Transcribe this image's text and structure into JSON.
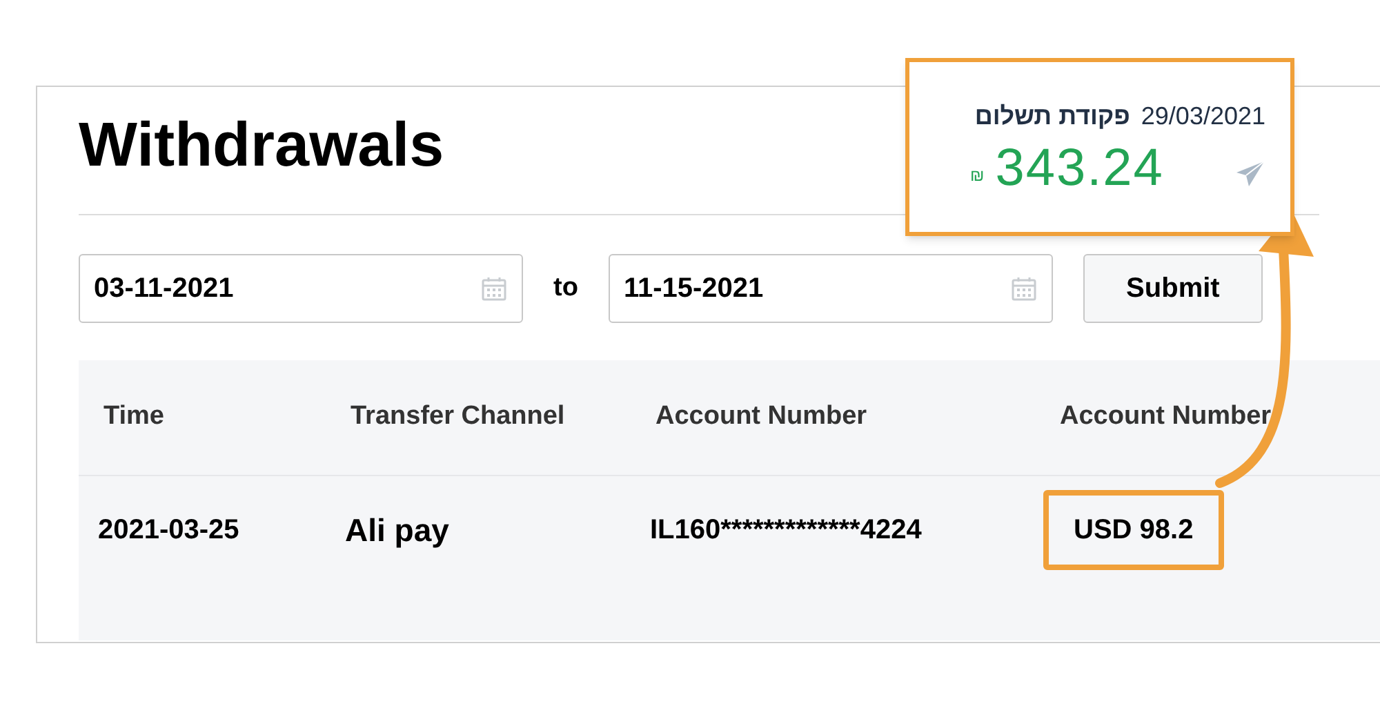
{
  "page": {
    "title": "Withdrawals"
  },
  "filter": {
    "from": "03-11-2021",
    "separator": "to",
    "until": "11-15-2021",
    "submit": "Submit"
  },
  "table": {
    "columns": [
      "Time",
      "Transfer Channel",
      "Account Number",
      "Account Number"
    ],
    "rows": [
      {
        "cells": [
          {
            "text": "2021-03-25",
            "highlighted": false
          },
          {
            "text": "Ali pay",
            "highlighted": false
          },
          {
            "text": "IL160*************4224",
            "highlighted": false
          },
          {
            "text": "USD 98.2",
            "highlighted": true
          }
        ]
      }
    ]
  },
  "callout": {
    "title": "פקודת תשלום",
    "date": "29/03/2021",
    "amount": "343.24",
    "currency": "₪"
  }
}
